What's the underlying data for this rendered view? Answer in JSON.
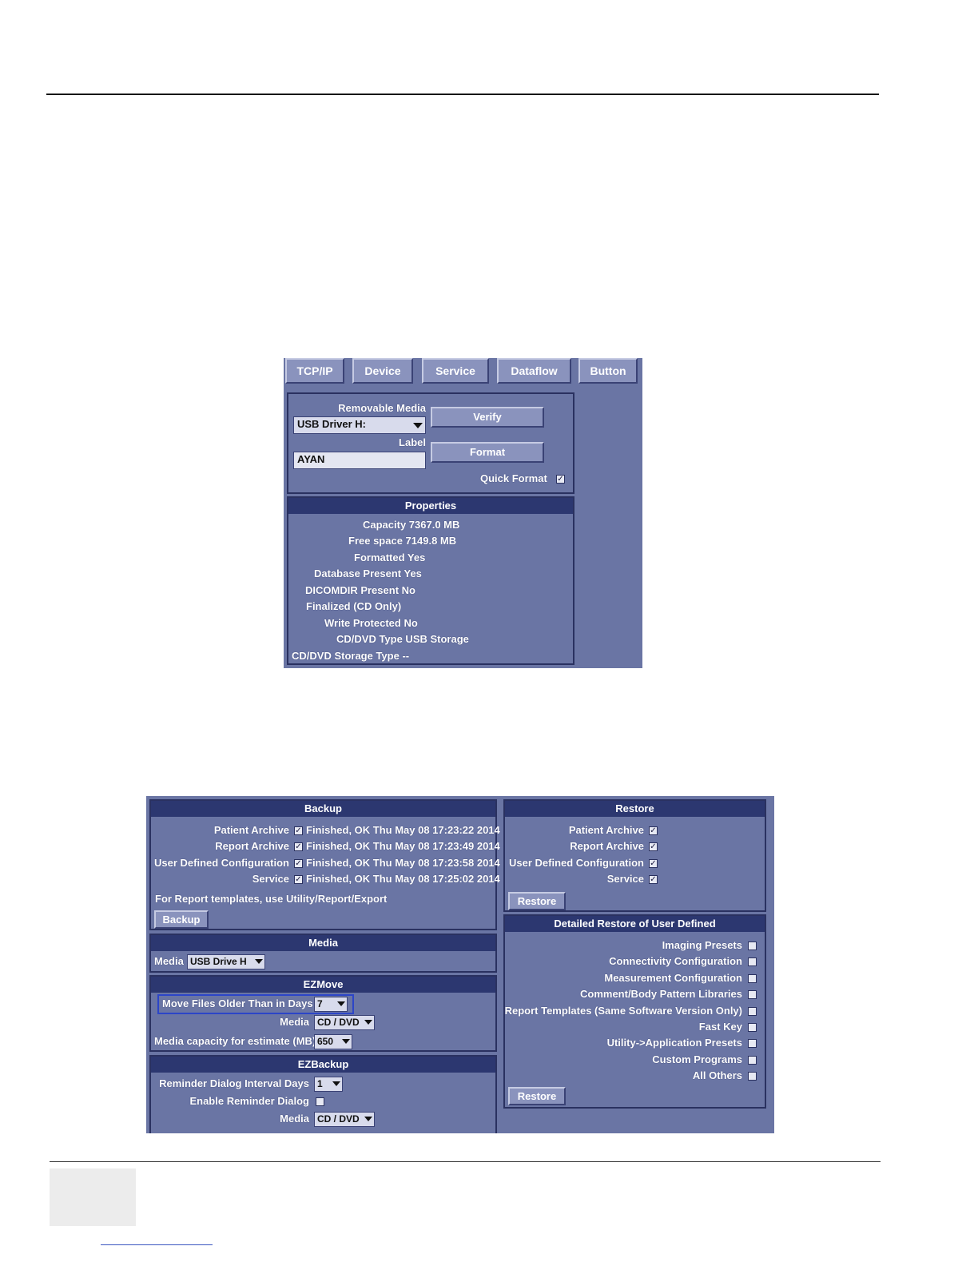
{
  "tabs": [
    "TCP/IP",
    "Device",
    "Service",
    "Dataflow",
    "Button"
  ],
  "device": {
    "removable_media_label": "Removable Media",
    "removable_media_value": "USB Driver H:",
    "label_label": "Label",
    "label_value": "AYAN",
    "verify_button": "Verify",
    "format_button": "Format",
    "quick_format_label": "Quick Format",
    "quick_format_checked": true,
    "properties_title": "Properties",
    "properties": [
      "Capacity 7367.0 MB",
      "Free space 7149.8 MB",
      "Formatted Yes",
      "Database Present Yes",
      "DICOMDIR Present No",
      "Finalized (CD Only)",
      "Write Protected No",
      "CD/DVD Type USB Storage",
      "CD/DVD Storage Type --"
    ]
  },
  "backup": {
    "title": "Backup",
    "items": [
      {
        "label": "Patient Archive",
        "checked": true,
        "status": "Finished, OK Thu May 08 17:23:22 2014"
      },
      {
        "label": "Report Archive",
        "checked": true,
        "status": "Finished, OK Thu May 08 17:23:49 2014"
      },
      {
        "label": "User Defined Configuration",
        "checked": true,
        "status": "Finished, OK Thu May 08 17:23:58 2014"
      },
      {
        "label": "Service",
        "checked": true,
        "status": "Finished, OK Thu May 08 17:25:02 2014"
      }
    ],
    "note": "For Report templates, use Utility/Report/Export",
    "button": "Backup"
  },
  "media": {
    "title": "Media",
    "label": "Media",
    "value": "USB Drive H"
  },
  "ezmove": {
    "title": "EZMove",
    "move_files_label": "Move Files Older Than in Days",
    "move_files_value": "7",
    "media_label": "Media",
    "media_value": "CD / DVD",
    "capacity_label": "Media capacity for estimate (MB)",
    "capacity_value": "650"
  },
  "ezbackup": {
    "title": "EZBackup",
    "reminder_label": "Reminder Dialog Interval Days",
    "reminder_value": "1",
    "enable_label": "Enable Reminder Dialog",
    "enable_checked": false,
    "media_label": "Media",
    "media_value": "CD / DVD"
  },
  "restore": {
    "title": "Restore",
    "items": [
      {
        "label": "Patient Archive",
        "checked": true
      },
      {
        "label": "Report Archive",
        "checked": true
      },
      {
        "label": "User Defined Configuration",
        "checked": true
      },
      {
        "label": "Service",
        "checked": true
      }
    ],
    "button": "Restore"
  },
  "detailed_restore": {
    "title": "Detailed Restore of User Defined",
    "items": [
      "Imaging Presets",
      "Connectivity Configuration",
      "Measurement Configuration",
      "Comment/Body Pattern Libraries",
      "Report Templates (Same Software Version Only)",
      "Fast Key",
      "Utility->Application Presets",
      "Custom Programs",
      "All Others"
    ],
    "button": "Restore"
  }
}
